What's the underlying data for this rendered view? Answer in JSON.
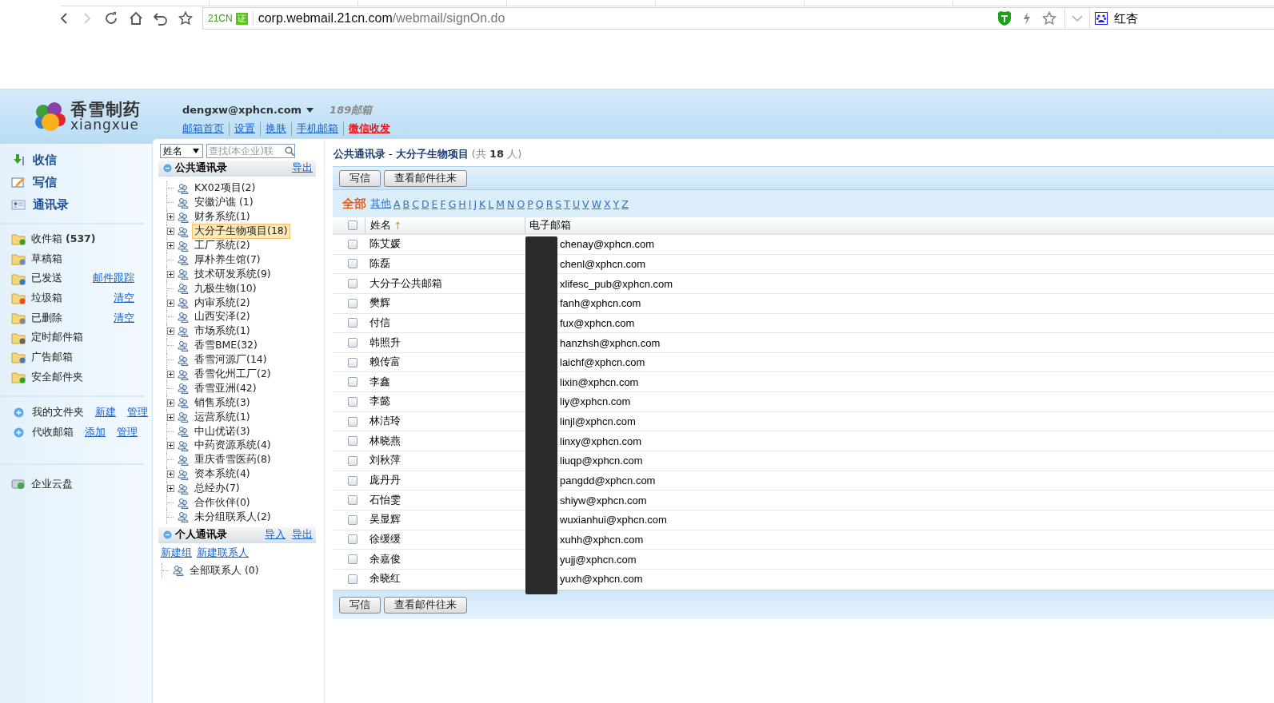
{
  "browser": {
    "site_badge": "21CN",
    "cert_badge": "证",
    "url_host": "corp.webmail.21cn.com",
    "url_path": "/webmail/signOn.do",
    "profile": "红杏"
  },
  "header": {
    "logo_name": "香雪制药",
    "logo_subtitle": "xiangxue",
    "account": "dengxw@xphcn.com",
    "brand": "189邮箱",
    "links": [
      {
        "label": "邮箱首页",
        "kind": "normal"
      },
      {
        "label": "设置",
        "kind": "normal"
      },
      {
        "label": "换肤",
        "kind": "normal"
      },
      {
        "label": "手机邮箱",
        "kind": "normal"
      },
      {
        "label": "微信收发",
        "kind": "highlight"
      }
    ]
  },
  "sidebar": {
    "nav": [
      {
        "label": "收信",
        "kind": "receive"
      },
      {
        "label": "写信",
        "kind": "compose"
      },
      {
        "label": "通讯录",
        "kind": "contacts"
      }
    ],
    "folders": [
      {
        "label": "收件箱",
        "count": "(537)",
        "kind": "inbox"
      },
      {
        "label": "草稿箱",
        "kind": "draft"
      },
      {
        "label": "已发送",
        "kind": "sent",
        "actions": [
          "邮件跟踪"
        ]
      },
      {
        "label": "垃圾箱",
        "kind": "spam",
        "actions": [
          "清空"
        ]
      },
      {
        "label": "已删除",
        "kind": "trash",
        "actions": [
          "清空"
        ]
      },
      {
        "label": "定时邮件箱",
        "kind": "timer"
      },
      {
        "label": "广告邮箱",
        "kind": "ads"
      },
      {
        "label": "安全邮件夹",
        "kind": "safe"
      }
    ],
    "my_folders": [
      {
        "label": "我的文件夹",
        "actions": [
          "新建",
          "管理"
        ]
      },
      {
        "label": "代收邮箱",
        "actions": [
          "添加",
          "管理"
        ]
      }
    ],
    "cloud": "企业云盘"
  },
  "contacts": {
    "search_type": "姓名",
    "search_placeholder": "查找(本企业)联",
    "public": {
      "title": "公共通讯录",
      "actions": [
        "导出"
      ],
      "groups": [
        {
          "label": "KX02项目(2)",
          "has_children": false,
          "selected": false
        },
        {
          "label": "安徽沪谯 (1)",
          "has_children": false,
          "selected": false
        },
        {
          "label": "财务系统(1)",
          "has_children": true,
          "selected": false
        },
        {
          "label": "大分子生物项目(18)",
          "has_children": true,
          "selected": true
        },
        {
          "label": "工厂系统(2)",
          "has_children": true,
          "selected": false
        },
        {
          "label": "厚朴养生馆(7)",
          "has_children": false,
          "selected": false
        },
        {
          "label": "技术研发系统(9)",
          "has_children": true,
          "selected": false
        },
        {
          "label": "九极生物(10)",
          "has_children": false,
          "selected": false
        },
        {
          "label": "内审系统(2)",
          "has_children": true,
          "selected": false
        },
        {
          "label": "山西安泽(2)",
          "has_children": false,
          "selected": false
        },
        {
          "label": "市场系统(1)",
          "has_children": true,
          "selected": false
        },
        {
          "label": "香雪BME(32)",
          "has_children": false,
          "selected": false
        },
        {
          "label": "香雪河源厂(14)",
          "has_children": false,
          "selected": false
        },
        {
          "label": "香雪化州工厂(2)",
          "has_children": true,
          "selected": false
        },
        {
          "label": "香雪亚洲(42)",
          "has_children": false,
          "selected": false
        },
        {
          "label": "销售系统(3)",
          "has_children": true,
          "selected": false
        },
        {
          "label": "运营系统(1)",
          "has_children": true,
          "selected": false
        },
        {
          "label": "中山优诺(3)",
          "has_children": false,
          "selected": false
        },
        {
          "label": "中药资源系统(4)",
          "has_children": true,
          "selected": false
        },
        {
          "label": "重庆香雪医药(8)",
          "has_children": false,
          "selected": false
        },
        {
          "label": "资本系统(4)",
          "has_children": true,
          "selected": false
        },
        {
          "label": "总经办(7)",
          "has_children": true,
          "selected": false
        },
        {
          "label": "合作伙伴(0)",
          "has_children": false,
          "selected": false
        },
        {
          "label": "未分组联系人(2)",
          "has_children": false,
          "selected": false
        }
      ]
    },
    "personal": {
      "title": "个人通讯录",
      "actions": [
        "导入",
        "导出"
      ],
      "links": [
        "新建组",
        "新建联系人"
      ],
      "groups": [
        {
          "label": "全部联系人 (0)",
          "has_children": false,
          "selected": false
        }
      ]
    }
  },
  "main": {
    "title": "公共通讯录",
    "separator": "-",
    "group": "大分子生物项目",
    "count_prefix": "(共",
    "count": "18",
    "count_suffix": "人)",
    "buttons": [
      "写信",
      "查看邮件往来"
    ],
    "letters": [
      {
        "label": "全部",
        "selected": true
      },
      {
        "label": "其他",
        "selected": false
      },
      {
        "label": "A",
        "selected": false
      },
      {
        "label": "B",
        "selected": false
      },
      {
        "label": "C",
        "selected": false
      },
      {
        "label": "D",
        "selected": false
      },
      {
        "label": "E",
        "selected": false
      },
      {
        "label": "F",
        "selected": false
      },
      {
        "label": "G",
        "selected": false
      },
      {
        "label": "H",
        "selected": false
      },
      {
        "label": "I",
        "selected": false
      },
      {
        "label": "J",
        "selected": false
      },
      {
        "label": "K",
        "selected": false
      },
      {
        "label": "L",
        "selected": false
      },
      {
        "label": "M",
        "selected": false
      },
      {
        "label": "N",
        "selected": false
      },
      {
        "label": "O",
        "selected": false
      },
      {
        "label": "P",
        "selected": false
      },
      {
        "label": "Q",
        "selected": false
      },
      {
        "label": "R",
        "selected": false
      },
      {
        "label": "S",
        "selected": false
      },
      {
        "label": "T",
        "selected": false
      },
      {
        "label": "U",
        "selected": false
      },
      {
        "label": "V",
        "selected": false
      },
      {
        "label": "W",
        "selected": false
      },
      {
        "label": "X",
        "selected": false
      },
      {
        "label": "Y",
        "selected": false
      },
      {
        "label": "Z",
        "selected": false
      }
    ],
    "all_checked": false,
    "columns": [
      {
        "label": "姓名",
        "sort": "↑"
      },
      {
        "label": "电子邮箱"
      }
    ],
    "rows": [
      {
        "name": "陈艾媛",
        "email": "chenay@xphcn.com",
        "checked": false
      },
      {
        "name": "陈磊",
        "email": "chenl@xphcn.com",
        "checked": false
      },
      {
        "name": "大分子公共邮箱",
        "email": "xlifesc_pub@xphcn.com",
        "checked": false
      },
      {
        "name": "樊辉",
        "email": "fanh@xphcn.com",
        "checked": false
      },
      {
        "name": "付信",
        "email": "fux@xphcn.com",
        "checked": false
      },
      {
        "name": "韩照升",
        "email": "hanzhsh@xphcn.com",
        "checked": false
      },
      {
        "name": "赖传富",
        "email": "laichf@xphcn.com",
        "checked": false
      },
      {
        "name": "李鑫",
        "email": "lixin@xphcn.com",
        "checked": false
      },
      {
        "name": "李懿",
        "email": "liy@xphcn.com",
        "checked": false
      },
      {
        "name": "林洁玲",
        "email": "linjl@xphcn.com",
        "checked": false
      },
      {
        "name": "林晓燕",
        "email": "linxy@xphcn.com",
        "checked": false
      },
      {
        "name": "刘秋萍",
        "email": "liuqp@xphcn.com",
        "checked": false
      },
      {
        "name": "庞丹丹",
        "email": "pangdd@xphcn.com",
        "checked": false
      },
      {
        "name": "石怡雯",
        "email": "shiyw@xphcn.com",
        "checked": false
      },
      {
        "name": "吴显辉",
        "email": "wuxianhui@xphcn.com",
        "checked": false
      },
      {
        "name": "徐缓缓",
        "email": "xuhh@xphcn.com",
        "checked": false
      },
      {
        "name": "余嘉俊",
        "email": "yujj@xphcn.com",
        "checked": false
      },
      {
        "name": "余晓红",
        "email": "yuxh@xphcn.com",
        "checked": false
      }
    ],
    "bottom_buttons": [
      "写信",
      "查看邮件往来"
    ]
  }
}
